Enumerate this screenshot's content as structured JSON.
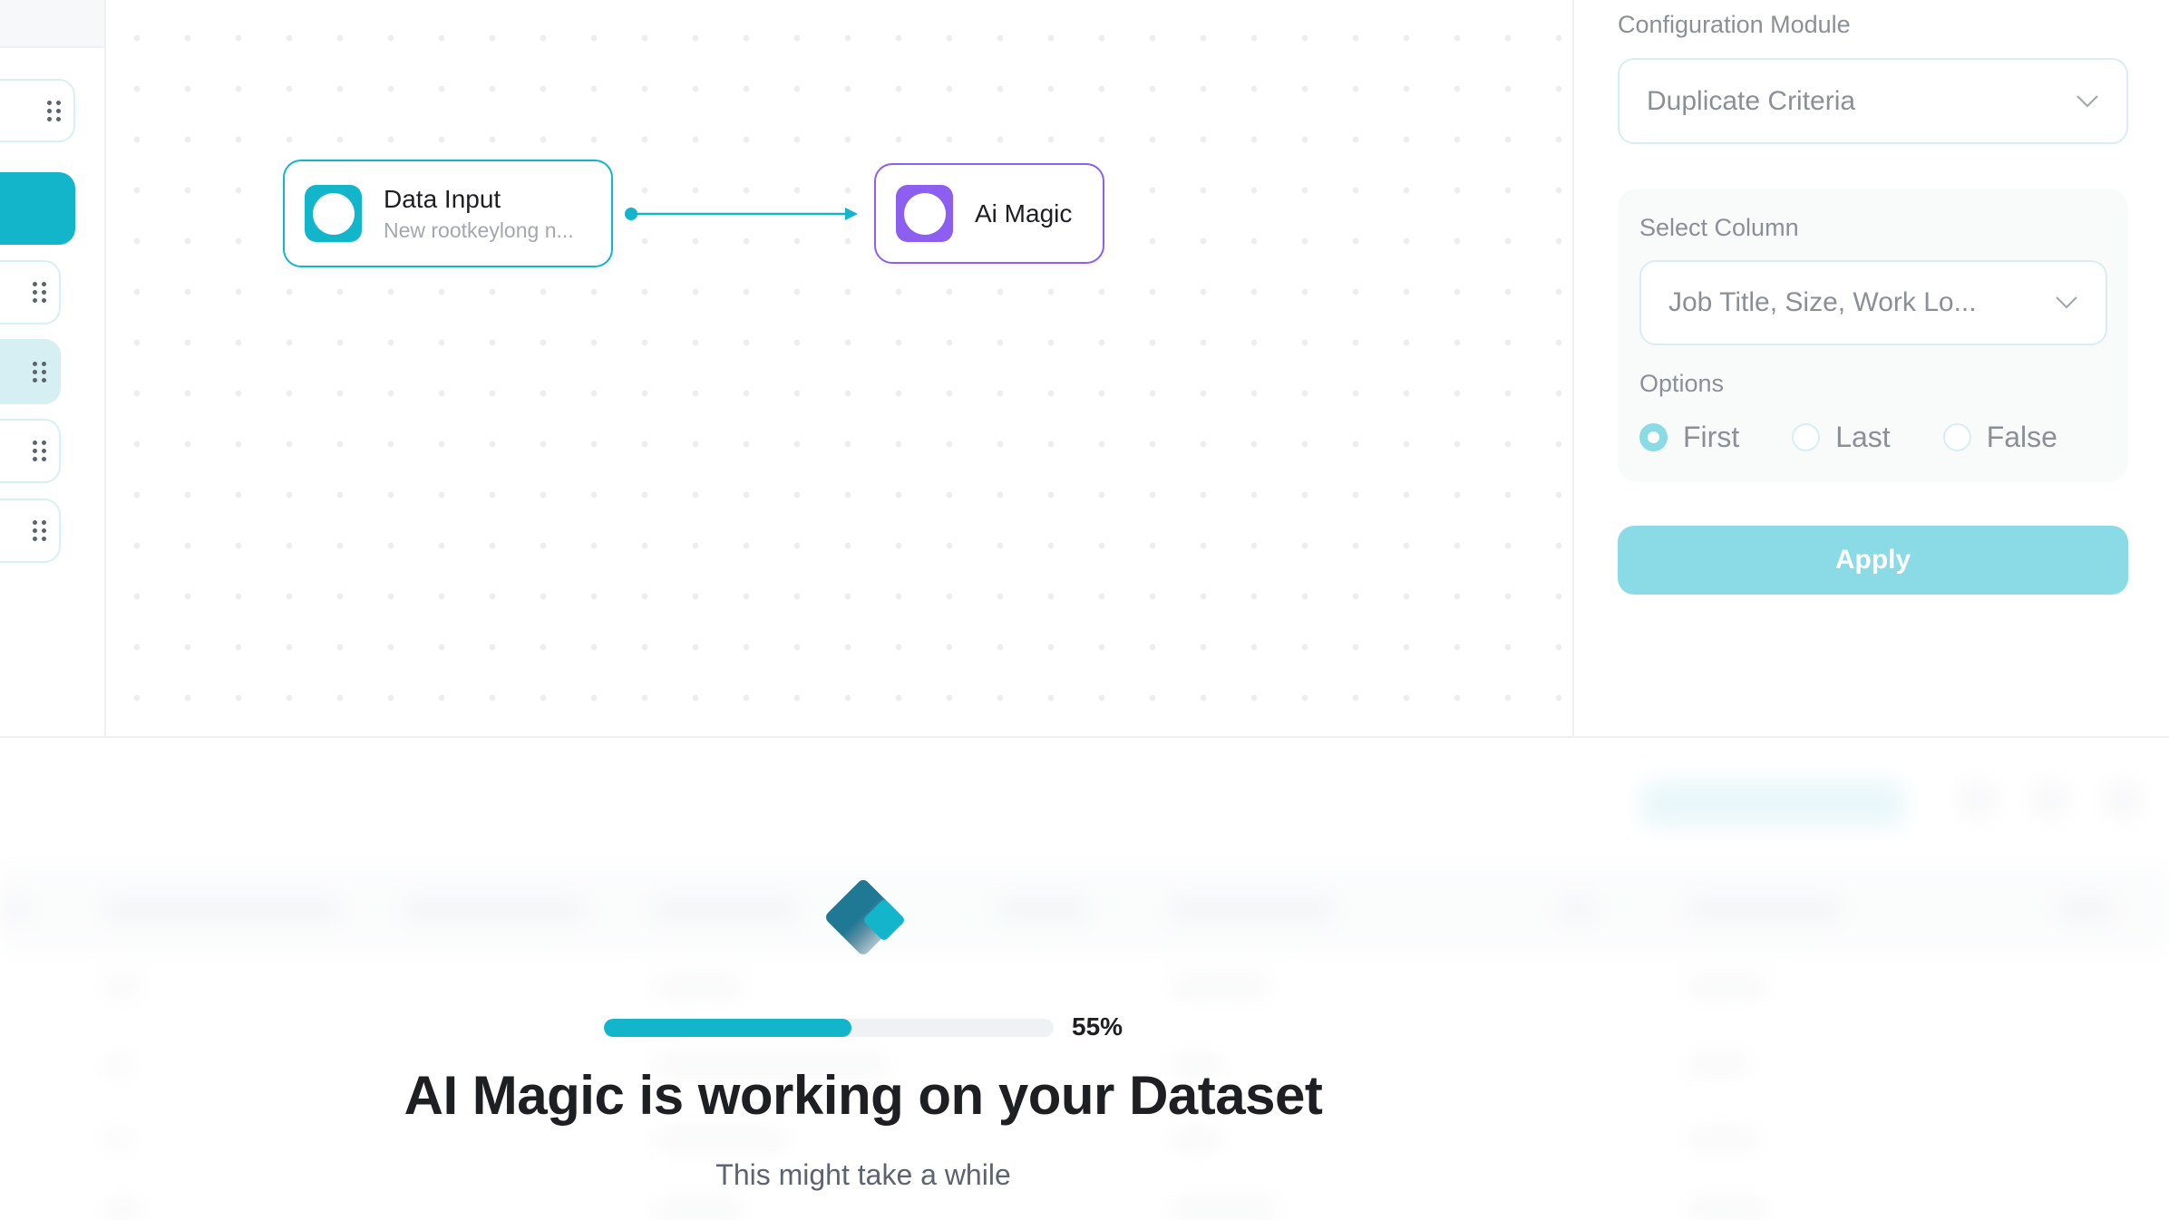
{
  "sidebar": {
    "items": [
      {
        "name": "module-1",
        "state": "default"
      },
      {
        "name": "module-2",
        "state": "active"
      },
      {
        "name": "module-3",
        "state": "default"
      },
      {
        "name": "module-4",
        "state": "hover"
      },
      {
        "name": "module-5",
        "state": "default"
      },
      {
        "name": "module-6",
        "state": "default"
      }
    ]
  },
  "canvas": {
    "nodes": [
      {
        "id": "data-input",
        "title": "Data Input",
        "subtitle": "New rootkeylong n...",
        "color": "#13b5cb"
      },
      {
        "id": "ai-magic",
        "title": "Ai Magic",
        "color": "#8c5ff0"
      }
    ],
    "edges": [
      {
        "from": "data-input",
        "to": "ai-magic"
      }
    ]
  },
  "config": {
    "module_label": "Configuration Module",
    "module_value": "Duplicate Criteria",
    "select_column_label": "Select Column",
    "select_column_value": "Job Title, Size, Work Lo...",
    "options_label": "Options",
    "options": [
      {
        "label": "First",
        "checked": true
      },
      {
        "label": "Last",
        "checked": false
      },
      {
        "label": "False",
        "checked": false
      }
    ],
    "apply_label": "Apply"
  },
  "overlay": {
    "progress_percent": 55,
    "progress_label": "55%",
    "title": "AI Magic is working on your Dataset",
    "subtitle": "This might take a while"
  },
  "colors": {
    "accent": "#13b5cb",
    "accent_light": "#8adbe5",
    "ai_purple": "#8c5ff0",
    "text_dark": "#1d1f22",
    "text_muted": "#8b9096"
  }
}
